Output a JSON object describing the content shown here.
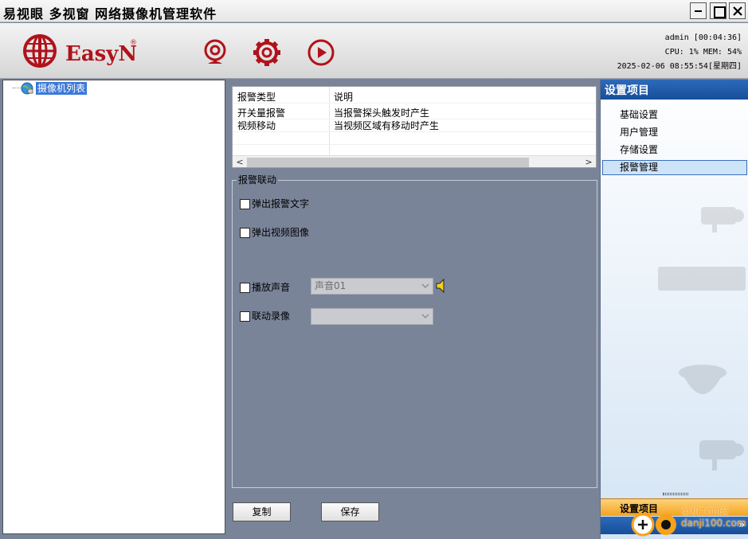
{
  "window": {
    "title": "易视眼 多视窗 网络摄像机管理软件"
  },
  "header": {
    "brand": "EasyN",
    "brand_mark": "®",
    "status_line1": "admin [00:04:36]",
    "status_line2": "CPU:  1%  MEM: 54%",
    "status_line3": "2025-02-06 08:55:54[星期四]",
    "icons": [
      "webcam-icon",
      "settings-gear-icon",
      "playback-icon"
    ],
    "accent": "#b0121b"
  },
  "tree": {
    "root_label": "摄像机列表"
  },
  "alarm_list": {
    "columns": [
      "报警类型",
      "说明"
    ],
    "rows": [
      {
        "type": "开关量报警",
        "desc": "当报警探头触发时产生"
      },
      {
        "type": "视频移动",
        "desc": "当视频区域有移动时产生"
      }
    ]
  },
  "linkage": {
    "title": "报警联动",
    "popup_text": "弹出报警文字",
    "popup_image": "弹出视频图像",
    "play_sound": "播放声音",
    "sound_value": "声音01",
    "link_record": "联动录像",
    "record_value": ""
  },
  "buttons": {
    "copy": "复制",
    "save": "保存"
  },
  "right_panel": {
    "title": "设置项目",
    "items": [
      "基础设置",
      "用户管理",
      "存储设置",
      "报警管理"
    ],
    "selected": "报警管理",
    "bottom_label": "设置项目",
    "expand": "»"
  },
  "watermark": {
    "line1": "单机100网",
    "line2": "danji100.com"
  }
}
